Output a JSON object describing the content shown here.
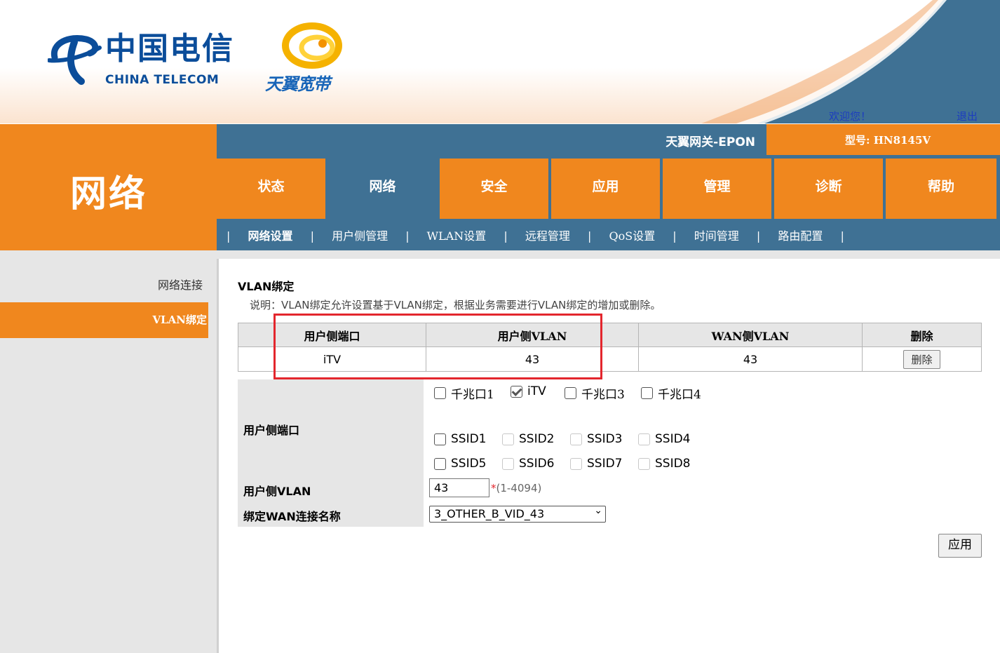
{
  "header": {
    "brand_cn": "中国电信",
    "brand_en": "CHINA TELECOM",
    "brand_tianyi": "天翼宽带",
    "welcome": "欢迎您！",
    "logout": "退出",
    "gateway_title": "天翼网关-EPON",
    "model": "型号: HN8145V"
  },
  "section_title": "网络",
  "nav": {
    "items": [
      "状态",
      "网络",
      "安全",
      "应用",
      "管理",
      "诊断",
      "帮助"
    ],
    "active": "网络"
  },
  "subnav": {
    "items": [
      "网络设置",
      "用户侧管理",
      "WLAN设置",
      "远程管理",
      "QoS设置",
      "时间管理",
      "路由配置"
    ],
    "active": "网络设置",
    "separator": "|"
  },
  "sidebar": {
    "items": [
      "网络连接",
      "VLAN绑定"
    ],
    "active": "VLAN绑定"
  },
  "content": {
    "title": "VLAN绑定",
    "description": "说明：VLAN绑定允许设置基于VLAN绑定，根据业务需要进行VLAN绑定的增加或删除。",
    "table": {
      "headers": [
        "用户侧端口",
        "用户侧VLAN",
        "WAN侧VLAN",
        "删除"
      ],
      "rows": [
        {
          "port": "iTV",
          "user_vlan": "43",
          "wan_vlan": "43",
          "delete_label": "删除"
        }
      ]
    },
    "form": {
      "port_label": "用户侧端口",
      "ports": [
        {
          "label": "千兆口1",
          "checked": false
        },
        {
          "label": "iTV",
          "checked": true
        },
        {
          "label": "千兆口3",
          "checked": false
        },
        {
          "label": "千兆口4",
          "checked": false
        }
      ],
      "ssids": [
        {
          "label": "SSID1",
          "enabled": true
        },
        {
          "label": "SSID2",
          "enabled": false
        },
        {
          "label": "SSID3",
          "enabled": false
        },
        {
          "label": "SSID4",
          "enabled": false
        },
        {
          "label": "SSID5",
          "enabled": true
        },
        {
          "label": "SSID6",
          "enabled": false
        },
        {
          "label": "SSID7",
          "enabled": false
        },
        {
          "label": "SSID8",
          "enabled": false
        }
      ],
      "vlan_label": "用户侧VLAN",
      "vlan_value": "43",
      "vlan_required": "*",
      "vlan_range": "(1-4094)",
      "wan_label": "绑定WAN连接名称",
      "wan_value": "3_OTHER_B_VID_43",
      "apply_label": "应用"
    }
  },
  "colors": {
    "orange": "#f0871e",
    "blue": "#3f7194",
    "highlight_red": "#e3262d"
  }
}
